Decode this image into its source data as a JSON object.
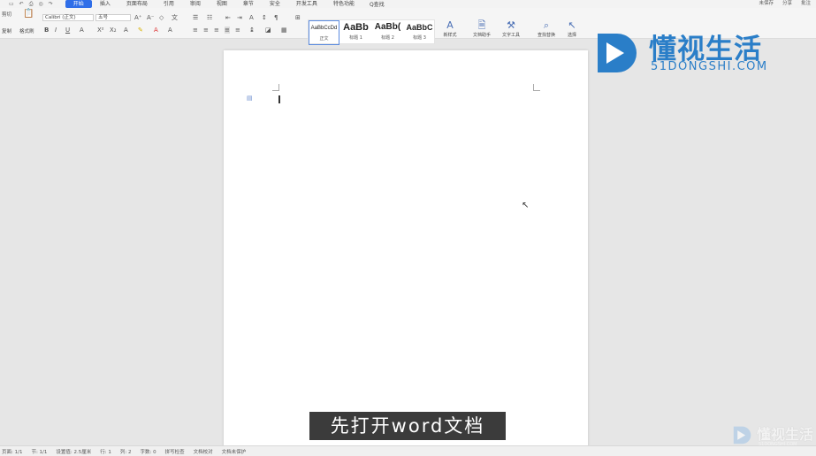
{
  "menu_tabs": [
    "开始",
    "插入",
    "页面布局",
    "引用",
    "审阅",
    "视图",
    "章节",
    "安全",
    "开发工具",
    "特色功能"
  ],
  "search_label": "Q查找",
  "top_right": [
    "未保存",
    "分享",
    "批注"
  ],
  "ribbon": {
    "cut": "剪切",
    "paste": "粘贴",
    "copy": "复制",
    "format_painter": "格式刷",
    "font_name": "Calibri (正文)",
    "font_size": "五号",
    "styles": [
      {
        "preview": "AaBbCcDd",
        "label": "正文"
      },
      {
        "preview": "AaBb",
        "label": "标题 1"
      },
      {
        "preview": "AaBb(",
        "label": "标题 2"
      },
      {
        "preview": "AaBbC",
        "label": "标题 3"
      }
    ],
    "new_style": "新样式",
    "doc_assistant": "文档助手",
    "text_tools": "文字工具",
    "find_replace": "查找替换",
    "select": "选择"
  },
  "status": [
    "页面: 1/1",
    "节: 1/1",
    "设置值: 2.5厘米",
    "行: 1",
    "列: 2",
    "字数: 0",
    "拼写检查",
    "文档校对",
    "文档未保护"
  ],
  "subtitle": "先打开word文档",
  "watermark": {
    "cn": "懂视生活",
    "en": "51DONGSHI.COM"
  },
  "watermark_small": {
    "cn": "懂视生活",
    "en": "51DONGSHI.COM"
  }
}
